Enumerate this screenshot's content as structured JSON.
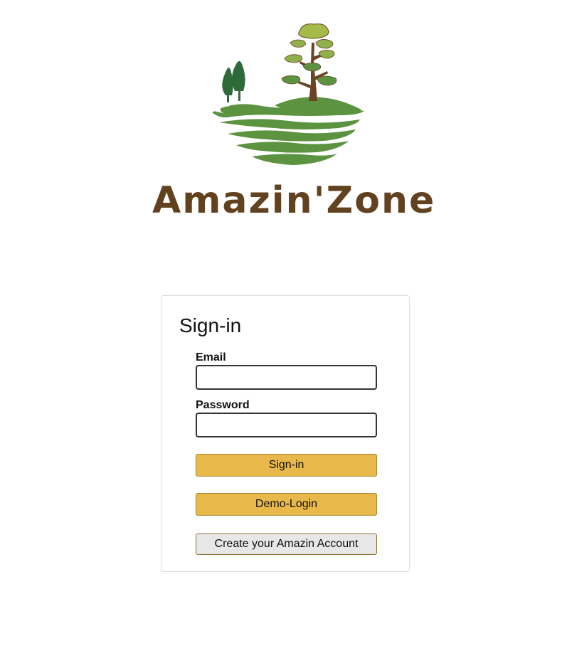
{
  "brand": {
    "name": "Amazin'Zone",
    "colors": {
      "brown": "#62411f",
      "green_dark": "#2f6b3a",
      "green": "#5c9340",
      "green_light": "#a4bb4a"
    }
  },
  "signin": {
    "title": "Sign-in",
    "email_label": "Email",
    "email_value": "",
    "password_label": "Password",
    "password_value": "",
    "signin_button": "Sign-in",
    "demo_button": "Demo-Login",
    "create_account_button": "Create your Amazin Account"
  },
  "colors": {
    "primary_button": "#e8b84a",
    "secondary_button": "#e7e7e7"
  }
}
